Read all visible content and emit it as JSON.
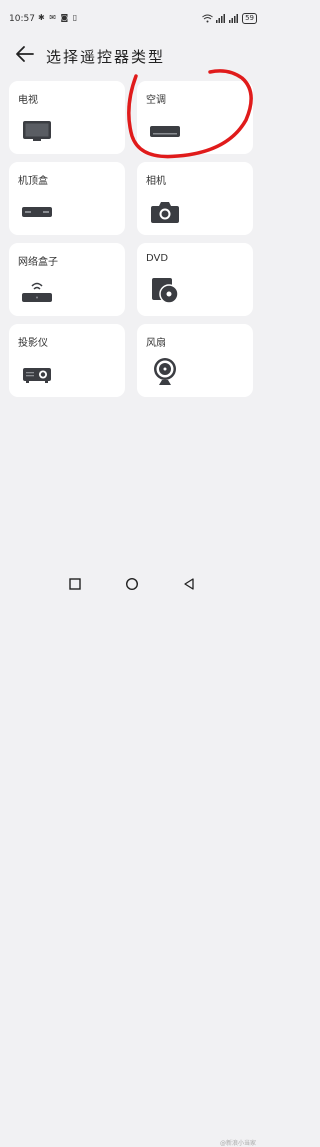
{
  "status_bar": {
    "time": "10:57",
    "left_icons": "✱ ✉ ◙ ▯",
    "battery": "59"
  },
  "header": {
    "title": "选择遥控器类型"
  },
  "devices": [
    {
      "label": "电视",
      "icon": "tv-icon"
    },
    {
      "label": "空调",
      "icon": "air-conditioner-icon"
    },
    {
      "label": "机顶盒",
      "icon": "set-top-box-icon"
    },
    {
      "label": "相机",
      "icon": "camera-icon"
    },
    {
      "label": "网络盒子",
      "icon": "network-box-icon"
    },
    {
      "label": "DVD",
      "icon": "dvd-icon"
    },
    {
      "label": "投影仪",
      "icon": "projector-icon"
    },
    {
      "label": "风扇",
      "icon": "fan-icon"
    }
  ],
  "annotation_color": "#e01b1b",
  "watermark": "@新浪小当家"
}
